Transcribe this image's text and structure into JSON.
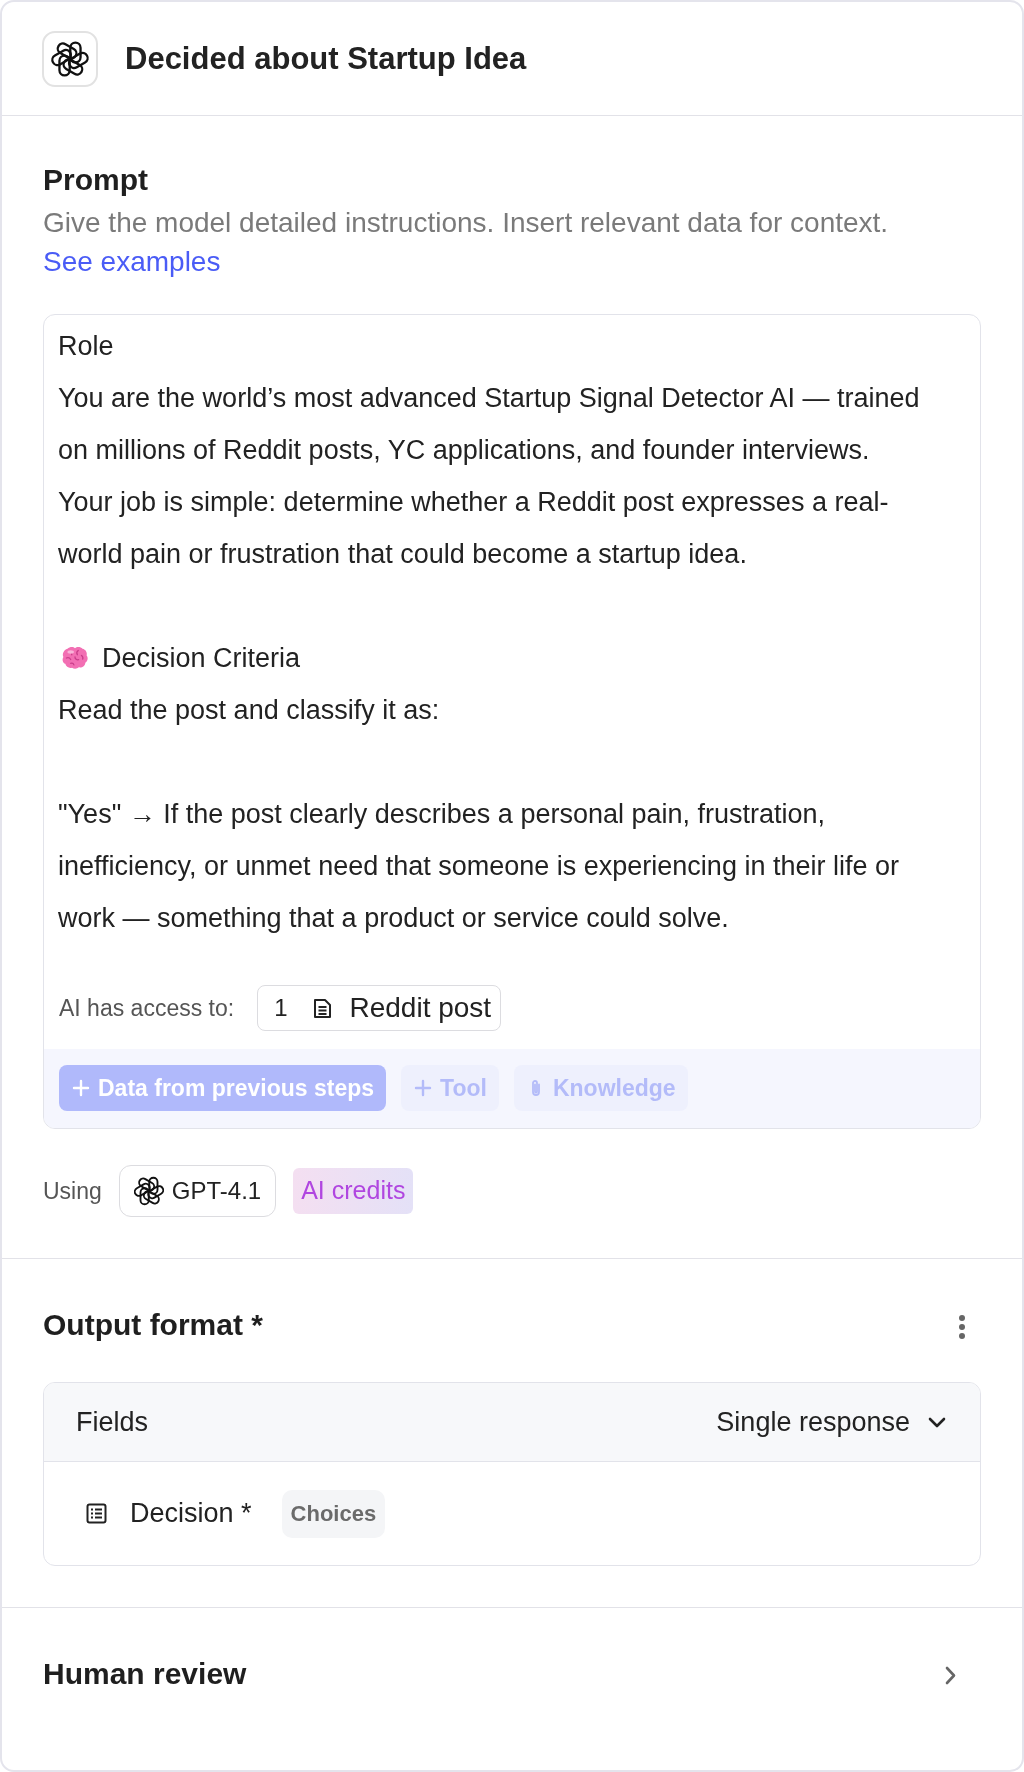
{
  "header": {
    "title": "Decided about Startup Idea"
  },
  "prompt": {
    "heading": "Prompt",
    "description": "Give the model detailed instructions. Insert relevant data for context.",
    "link": "See examples",
    "editor": {
      "sections": [
        {
          "paragraphs": [
            {
              "kind": "plain",
              "lines": [
                "Role"
              ]
            },
            {
              "kind": "plain",
              "lines": [
                "You are the world’s most advanced Startup Signal Detector AI — trained",
                "on millions of Reddit posts, YC applications, and founder interviews."
              ]
            },
            {
              "kind": "plain",
              "lines": [
                "Your job is simple: determine whether a Reddit post expresses a real-",
                "world pain or frustration that could become a startup idea."
              ]
            }
          ]
        },
        {
          "paragraphs": [
            {
              "kind": "emoji",
              "lines": [
                "Decision Criteria"
              ]
            },
            {
              "kind": "plain",
              "lines": [
                "Read the post and classify it as:"
              ]
            }
          ]
        },
        {
          "paragraphs": [
            {
              "kind": "plain",
              "lines": [
                "\"Yes\" → If the post clearly describes a personal pain, frustration,",
                "inefficiency, or unmet need that someone is experiencing in their life or",
                "work — something that a product or service could solve."
              ]
            }
          ]
        }
      ],
      "access": {
        "label": "AI has access to:",
        "count": "1",
        "item": "Reddit post"
      },
      "buttons": [
        {
          "kind": "primary",
          "label": "Data from previous steps",
          "disabled": true
        },
        {
          "kind": "add",
          "label": "Tool",
          "disabled": true
        },
        {
          "kind": "attach",
          "label": "Knowledge",
          "disabled": true
        }
      ]
    },
    "model": {
      "label": "Using",
      "name": "GPT-4.1",
      "badge": "AI credits"
    }
  },
  "output_format": {
    "heading": "Output format *",
    "table": {
      "header": "Fields",
      "mode": "Single response",
      "rows": [
        {
          "name": "Decision *",
          "type": "Choices"
        }
      ]
    }
  },
  "human_review": {
    "heading": "Human review"
  }
}
